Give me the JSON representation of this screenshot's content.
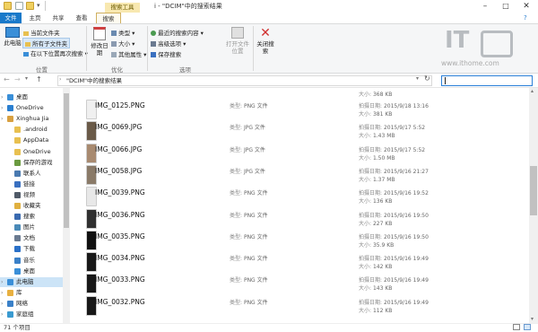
{
  "titlebar": {
    "tool_tab": "搜索工具",
    "title": "i - \"DCIM\"中的搜索结果"
  },
  "tabs": [
    "文件",
    "主页",
    "共享",
    "查看",
    "搜索"
  ],
  "ribbon": {
    "location_group": {
      "label": "位置",
      "this_pc": "此电脑",
      "current_folder": "当前文件夹",
      "all_subfolders": "所有子文件夹",
      "search_again": "在以下位置再次搜索 ▾"
    },
    "refine_group": {
      "label": "优化",
      "date_modified": "修改日期",
      "type": "类型 ▾",
      "size": "大小 ▾",
      "other_props": "其他属性 ▾"
    },
    "options_group": {
      "label": "选项",
      "recent_searches": "最近的搜索内容 ▾",
      "advanced": "高级选项 ▾",
      "save_search": "保存搜索",
      "open_location": "打开文件位置"
    },
    "close_search": "关闭搜索"
  },
  "logo": {
    "text": "IT",
    "url": "www.ithome.com"
  },
  "address": {
    "path": "\"DCIM\"中的搜索结果"
  },
  "sidebar": {
    "items": [
      {
        "label": "桌面",
        "icon": "desktop-icon",
        "color": "#3a8fd8",
        "level": 0
      },
      {
        "label": "OneDrive",
        "icon": "cloud-icon",
        "color": "#2a7fd0",
        "level": 0
      },
      {
        "label": "Xinghua Jia",
        "icon": "user-icon",
        "color": "#d8a040",
        "level": 0
      },
      {
        "label": ".android",
        "icon": "folder-icon",
        "color": "#e8c050",
        "level": 1
      },
      {
        "label": "AppData",
        "icon": "folder-icon",
        "color": "#e8c050",
        "level": 1
      },
      {
        "label": "OneDrive",
        "icon": "folder-icon",
        "color": "#e8c050",
        "level": 1
      },
      {
        "label": "保存的游戏",
        "icon": "game-icon",
        "color": "#6a9a40",
        "level": 1
      },
      {
        "label": "联系人",
        "icon": "contacts-icon",
        "color": "#4a7ab0",
        "level": 1
      },
      {
        "label": "链接",
        "icon": "link-icon",
        "color": "#3a70c0",
        "level": 1
      },
      {
        "label": "视频",
        "icon": "video-icon",
        "color": "#505a68",
        "level": 1
      },
      {
        "label": "收藏夹",
        "icon": "star-icon",
        "color": "#e0b040",
        "level": 1
      },
      {
        "label": "搜索",
        "icon": "search-icon",
        "color": "#3a6ab0",
        "level": 1
      },
      {
        "label": "图片",
        "icon": "pictures-icon",
        "color": "#4a8ab8",
        "level": 1
      },
      {
        "label": "文档",
        "icon": "documents-icon",
        "color": "#6a7a90",
        "level": 1
      },
      {
        "label": "下载",
        "icon": "download-icon",
        "color": "#2a70c8",
        "level": 1
      },
      {
        "label": "音乐",
        "icon": "music-icon",
        "color": "#3a80c8",
        "level": 1
      },
      {
        "label": "桌面",
        "icon": "desktop-icon",
        "color": "#3a8fd8",
        "level": 1
      },
      {
        "label": "此电脑",
        "icon": "pc-icon",
        "color": "#3a8fd8",
        "level": 0,
        "selected": true
      },
      {
        "label": "库",
        "icon": "library-icon",
        "color": "#e8b040",
        "level": 0
      },
      {
        "label": "网络",
        "icon": "network-icon",
        "color": "#3a80c8",
        "level": 0
      },
      {
        "label": "家庭组",
        "icon": "homegroup-icon",
        "color": "#3a9ad0",
        "level": 0
      }
    ]
  },
  "list": {
    "type_label": "类型:",
    "date_label": "拍摄日期:",
    "size_label": "大小:",
    "top_partial_size": "368 KB",
    "files": [
      {
        "name": "IMG_0125.PNG",
        "type": "PNG 文件",
        "date": "2015/9/18 13:16",
        "size": "381 KB",
        "thumb": "#f0f0f0"
      },
      {
        "name": "IMG_0069.JPG",
        "type": "JPG 文件",
        "date": "2015/9/17 5:52",
        "size": "1.43 MB",
        "thumb": "#6a5a48"
      },
      {
        "name": "IMG_0066.JPG",
        "type": "JPG 文件",
        "date": "2015/9/17 5:52",
        "size": "1.50 MB",
        "thumb": "#a88a70"
      },
      {
        "name": "IMG_0058.JPG",
        "type": "JPG 文件",
        "date": "2015/9/16 21:27",
        "size": "1.37 MB",
        "thumb": "#8a7a68"
      },
      {
        "name": "IMG_0039.PNG",
        "type": "PNG 文件",
        "date": "2015/9/16 19:52",
        "size": "136 KB",
        "thumb": "#e8e8e8"
      },
      {
        "name": "IMG_0036.PNG",
        "type": "PNG 文件",
        "date": "2015/9/16 19:50",
        "size": "227 KB",
        "thumb": "#303030"
      },
      {
        "name": "IMG_0035.PNG",
        "type": "PNG 文件",
        "date": "2015/9/16 19:50",
        "size": "35.9 KB",
        "thumb": "#101010"
      },
      {
        "name": "IMG_0034.PNG",
        "type": "PNG 文件",
        "date": "2015/9/16 19:49",
        "size": "142 KB",
        "thumb": "#181818"
      },
      {
        "name": "IMG_0033.PNG",
        "type": "PNG 文件",
        "date": "2015/9/16 19:49",
        "size": "143 KB",
        "thumb": "#181818"
      },
      {
        "name": "IMG_0032.PNG",
        "type": "PNG 文件",
        "date": "2015/9/16 19:49",
        "size": "112 KB",
        "thumb": "#181818"
      }
    ]
  },
  "status": {
    "count": "71 个项目"
  },
  "colors": {
    "accent": "#1979ca",
    "search_tab": "#f8e8b0",
    "close_x": "#d03030"
  }
}
